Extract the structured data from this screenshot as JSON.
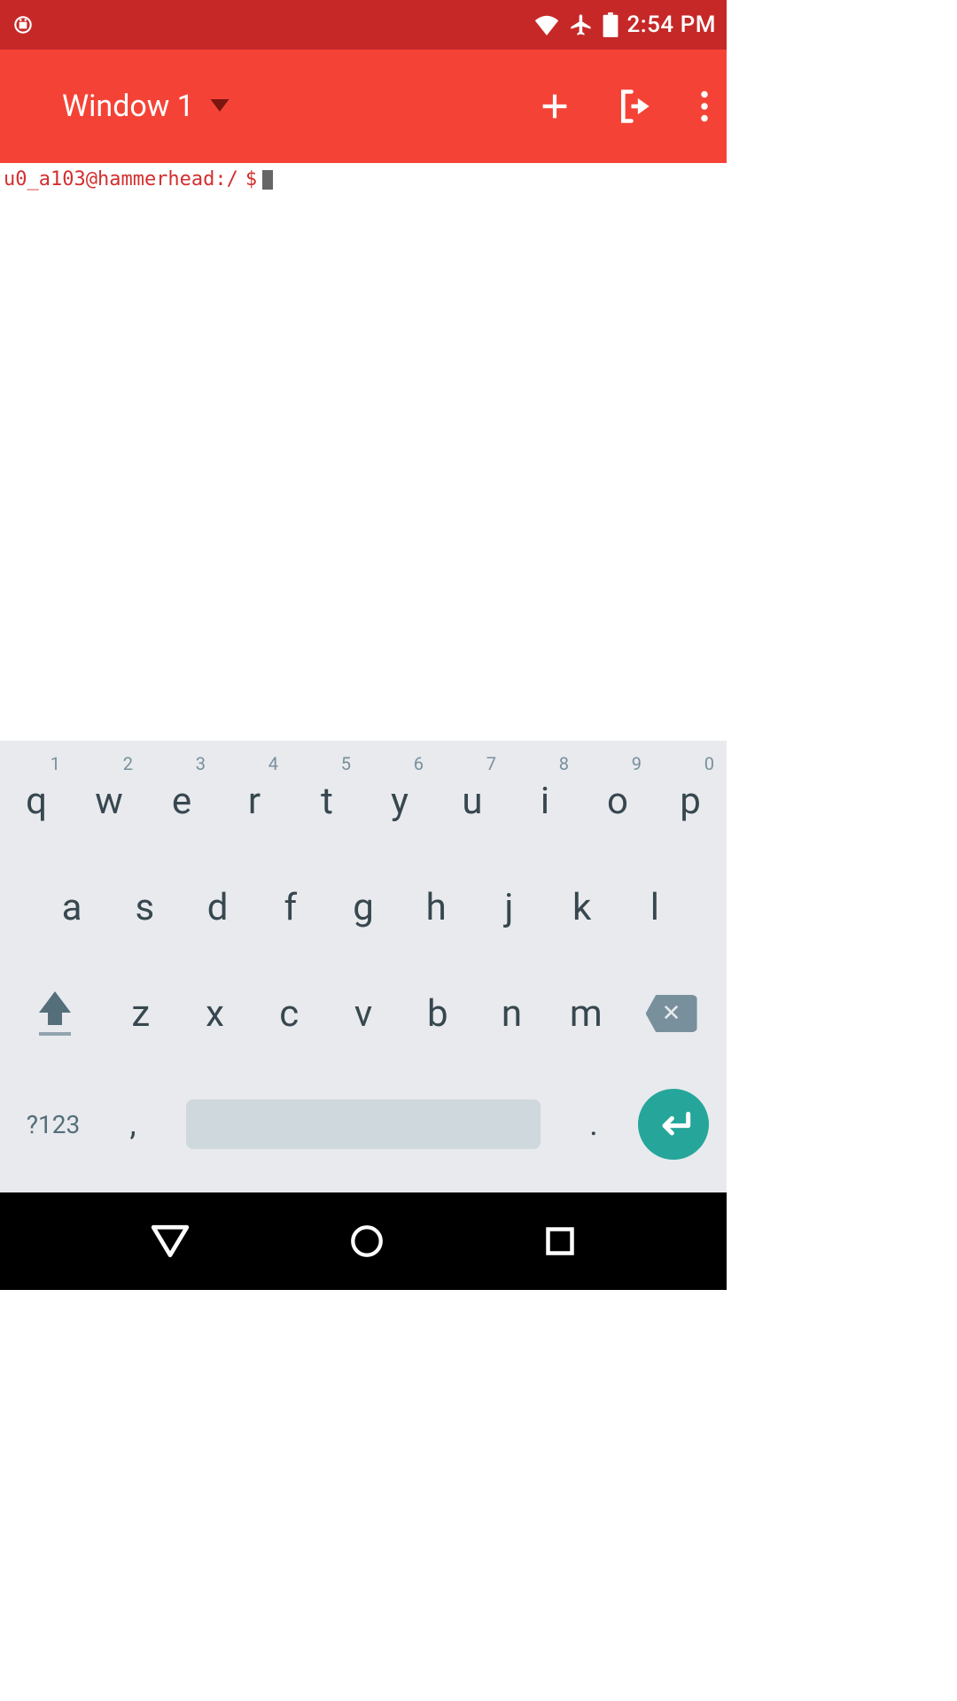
{
  "status_bar": {
    "time": "2:54 PM"
  },
  "app_bar": {
    "window_title": "Window 1"
  },
  "terminal": {
    "prompt_user": "u0_a103@hammerhead:/",
    "prompt_symbol": "$"
  },
  "keyboard": {
    "row1": [
      {
        "main": "q",
        "hint": "1"
      },
      {
        "main": "w",
        "hint": "2"
      },
      {
        "main": "e",
        "hint": "3"
      },
      {
        "main": "r",
        "hint": "4"
      },
      {
        "main": "t",
        "hint": "5"
      },
      {
        "main": "y",
        "hint": "6"
      },
      {
        "main": "u",
        "hint": "7"
      },
      {
        "main": "i",
        "hint": "8"
      },
      {
        "main": "o",
        "hint": "9"
      },
      {
        "main": "p",
        "hint": "0"
      }
    ],
    "row2": [
      "a",
      "s",
      "d",
      "f",
      "g",
      "h",
      "j",
      "k",
      "l"
    ],
    "row3": [
      "z",
      "x",
      "c",
      "v",
      "b",
      "n",
      "m"
    ],
    "symbols_label": "?123",
    "comma": ",",
    "period": "."
  }
}
